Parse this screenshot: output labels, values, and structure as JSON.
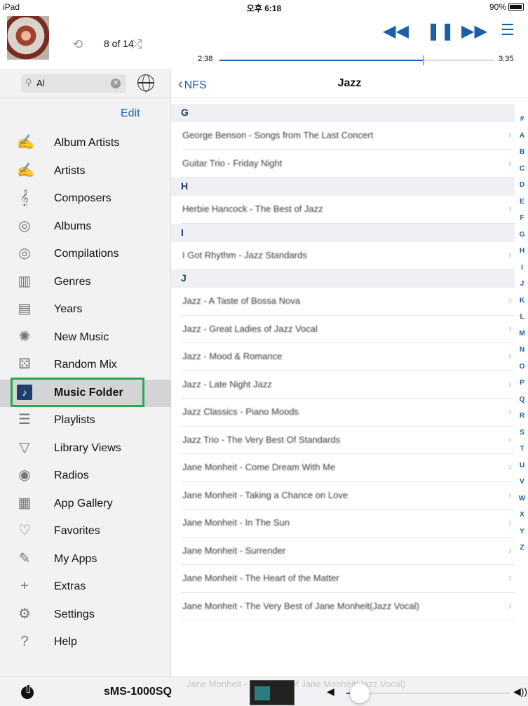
{
  "status_bar": {
    "device": "iPad",
    "time": "오후 6:18",
    "battery": "90%"
  },
  "now_playing": {
    "track_count": "8 of 14",
    "elapsed": "2:38",
    "total": "3:35",
    "progress": 0.74,
    "icons": {
      "repeat": "repeat-icon",
      "shuffle": "shuffle-icon",
      "prev": "rewind-icon",
      "pause": "pause-icon",
      "next": "fast-forward-icon",
      "queue": "queue-list-icon"
    }
  },
  "search": {
    "value": "Al"
  },
  "sidebar": {
    "edit_label": "Edit",
    "items": [
      {
        "label": "Album Artists",
        "icon": "album-artists-icon",
        "glyph": "✍"
      },
      {
        "label": "Artists",
        "icon": "artists-icon",
        "glyph": "✍"
      },
      {
        "label": "Composers",
        "icon": "treble-clef-icon",
        "glyph": "𝄞"
      },
      {
        "label": "Albums",
        "icon": "albums-icon",
        "glyph": "◎"
      },
      {
        "label": "Compilations",
        "icon": "compilations-icon",
        "glyph": "◎"
      },
      {
        "label": "Genres",
        "icon": "piano-keys-icon",
        "glyph": "▥"
      },
      {
        "label": "Years",
        "icon": "calendar-1979-icon",
        "glyph": "▤"
      },
      {
        "label": "New Music",
        "icon": "new-music-icon",
        "glyph": "✺"
      },
      {
        "label": "Random Mix",
        "icon": "dice-icon",
        "glyph": "⚄"
      },
      {
        "label": "Music Folder",
        "icon": "music-folder-icon",
        "glyph": "♪",
        "selected": true
      },
      {
        "label": "Playlists",
        "icon": "playlists-icon",
        "glyph": "☰"
      },
      {
        "label": "Library Views",
        "icon": "funnel-icon",
        "glyph": "▽"
      },
      {
        "label": "Radios",
        "icon": "radio-tower-icon",
        "glyph": "◉"
      },
      {
        "label": "App Gallery",
        "icon": "app-gallery-icon",
        "glyph": "▦"
      },
      {
        "label": "Favorites",
        "icon": "heart-icon",
        "glyph": "♡"
      },
      {
        "label": "My Apps",
        "icon": "my-apps-icon",
        "glyph": "✎"
      },
      {
        "label": "Extras",
        "icon": "plus-icon",
        "glyph": "+"
      },
      {
        "label": "Settings",
        "icon": "gear-icon",
        "glyph": "⚙"
      },
      {
        "label": "Help",
        "icon": "help-icon",
        "glyph": "?"
      }
    ]
  },
  "main": {
    "back_label": "NFS",
    "title": "Jazz",
    "sections": [
      {
        "letter": "G",
        "rows": [
          "George Benson - Songs from The Last Concert",
          "Guitar Trio - Friday Night"
        ]
      },
      {
        "letter": "H",
        "rows": [
          "Herbie Hancock - The Best of Jazz"
        ]
      },
      {
        "letter": "I",
        "rows": [
          "I Got Rhythm - Jazz Standards"
        ]
      },
      {
        "letter": "J",
        "rows": [
          "Jazz - A Taste of Bossa Nova",
          "Jazz - Great Ladies of Jazz Vocal",
          "Jazz - Mood & Romance",
          "Jazz - Late Night Jazz",
          "Jazz Classics - Piano Moods",
          "Jazz Trio - The Very Best Of Standards",
          "Jane Monheit - Come Dream With Me",
          "Jane Monheit - Taking a Chance on Love",
          "Jane Monheit - In The Sun",
          "Jane Monheit - Surrender",
          "Jane Monheit - The Heart of the Matter",
          "Jane Monheit - The Very Best of Jane Monheit(Jazz Vocal)"
        ]
      }
    ],
    "index": [
      "#",
      "A",
      "B",
      "C",
      "D",
      "E",
      "F",
      "G",
      "H",
      "I",
      "J",
      "K",
      "L",
      "M",
      "N",
      "O",
      "P",
      "Q",
      "R",
      "S",
      "T",
      "U",
      "V",
      "W",
      "X",
      "Y",
      "Z"
    ]
  },
  "footer": {
    "device_name": "sMS-1000SQ",
    "now_playing": "Jane Monheit - Very Best of Jane Monheit(Jazz Vocal)",
    "volume": 0.02
  }
}
